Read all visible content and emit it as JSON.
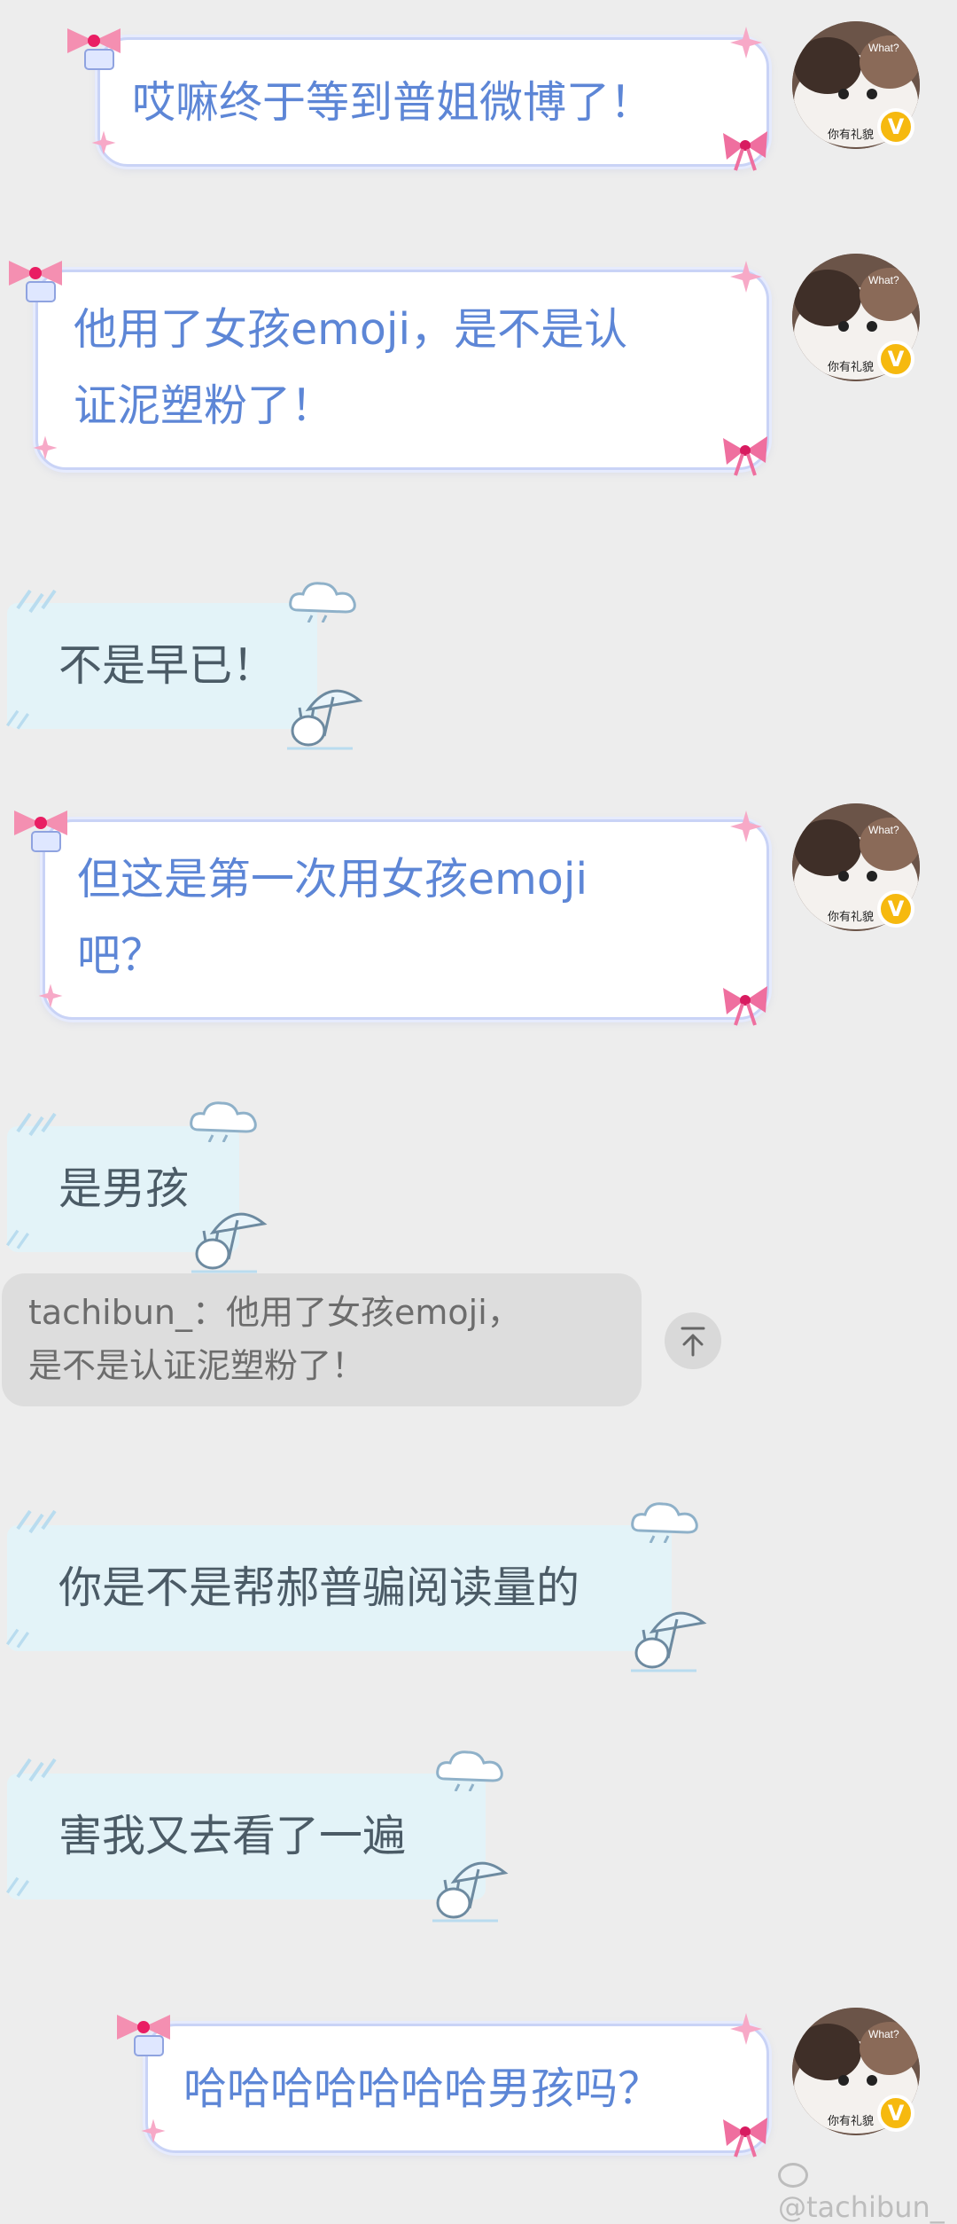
{
  "messages": [
    {
      "side": "out",
      "lines": [
        "哎嘛终于等到普姐微博了！"
      ]
    },
    {
      "side": "out",
      "lines": [
        "他用了女孩emoji，是不是认",
        "证泥塑粉了！"
      ]
    },
    {
      "side": "in",
      "lines": [
        "不是早已！"
      ]
    },
    {
      "side": "out",
      "lines": [
        "但这是第一次用女孩emoji",
        "吧？"
      ]
    },
    {
      "side": "in",
      "lines": [
        "是男孩"
      ]
    },
    {
      "side": "quote",
      "lines": [
        "tachibun_：他用了女孩emoji，",
        "是不是认证泥塑粉了！"
      ]
    },
    {
      "side": "in",
      "lines": [
        "你是不是帮郝普骗阅读量的"
      ]
    },
    {
      "side": "in",
      "lines": [
        "害我又去看了一遍"
      ]
    },
    {
      "side": "out",
      "lines": [
        "哈哈哈哈哈哈哈男孩吗？"
      ]
    }
  ],
  "avatar": {
    "overlay_text": "What?",
    "caption": "你有礼貌",
    "badge": "V"
  },
  "quote_jump_icon": "arrow-up-to-top-icon",
  "watermark": "@tachibun_",
  "colors": {
    "background": "#ededed",
    "out_text": "#5d86d6",
    "in_bubble": "#e3f3f8",
    "badge": "#f6b90f"
  }
}
